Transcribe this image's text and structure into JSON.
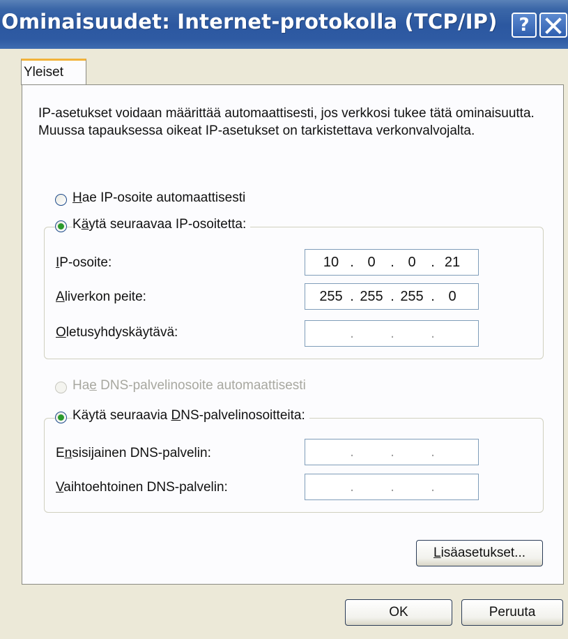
{
  "window": {
    "title": "Ominaisuudet: Internet-protokolla (TCP/IP)",
    "help_glyph": "?",
    "accent": "#2c58a0"
  },
  "tabs": [
    {
      "label": "Yleiset"
    }
  ],
  "intro": "IP-asetukset voidaan määrittää automaattisesti, jos verkkosi tukee tätä ominaisuutta. Muussa tapauksessa oikeat IP-asetukset on tarkistettava verkonvalvojalta.",
  "ip_mode": {
    "auto": {
      "key": "H",
      "rest": "ae IP-osoite automaattisesti",
      "checked": false
    },
    "manual": {
      "pre": "K",
      "key": "ä",
      "rest": "ytä seuraavaa IP-osoitetta:",
      "checked": true
    }
  },
  "ip_fields": {
    "address": {
      "key": "I",
      "rest": "P-osoite:",
      "octets": [
        "10",
        "0",
        "0",
        "21"
      ]
    },
    "subnet": {
      "key": "A",
      "rest": "liverkon peite:",
      "octets": [
        "255",
        "255",
        "255",
        "0"
      ]
    },
    "gateway": {
      "key": "O",
      "rest": "letusyhdyskäytävä:",
      "octets": [
        "",
        "",
        "",
        ""
      ]
    }
  },
  "dns_mode": {
    "auto": {
      "pre": "Ha",
      "key": "e",
      "rest": " DNS-palvelinosoite automaattisesti",
      "checked": false,
      "disabled": true
    },
    "manual": {
      "pre": "Käytä seuraavia ",
      "key": "D",
      "rest": "NS-palvelinosoitteita:",
      "checked": true
    }
  },
  "dns_fields": {
    "preferred": {
      "pre": "E",
      "key": "n",
      "rest": "sisijainen DNS-palvelin:",
      "octets": [
        "",
        "",
        "",
        ""
      ]
    },
    "alternate": {
      "key": "V",
      "rest": "aihtoehtoinen DNS-palvelin:",
      "octets": [
        "",
        "",
        "",
        ""
      ]
    }
  },
  "buttons": {
    "advanced": {
      "key": "L",
      "rest": "isäasetukset..."
    },
    "ok": "OK",
    "cancel": "Peruuta"
  },
  "separator_dot": "."
}
